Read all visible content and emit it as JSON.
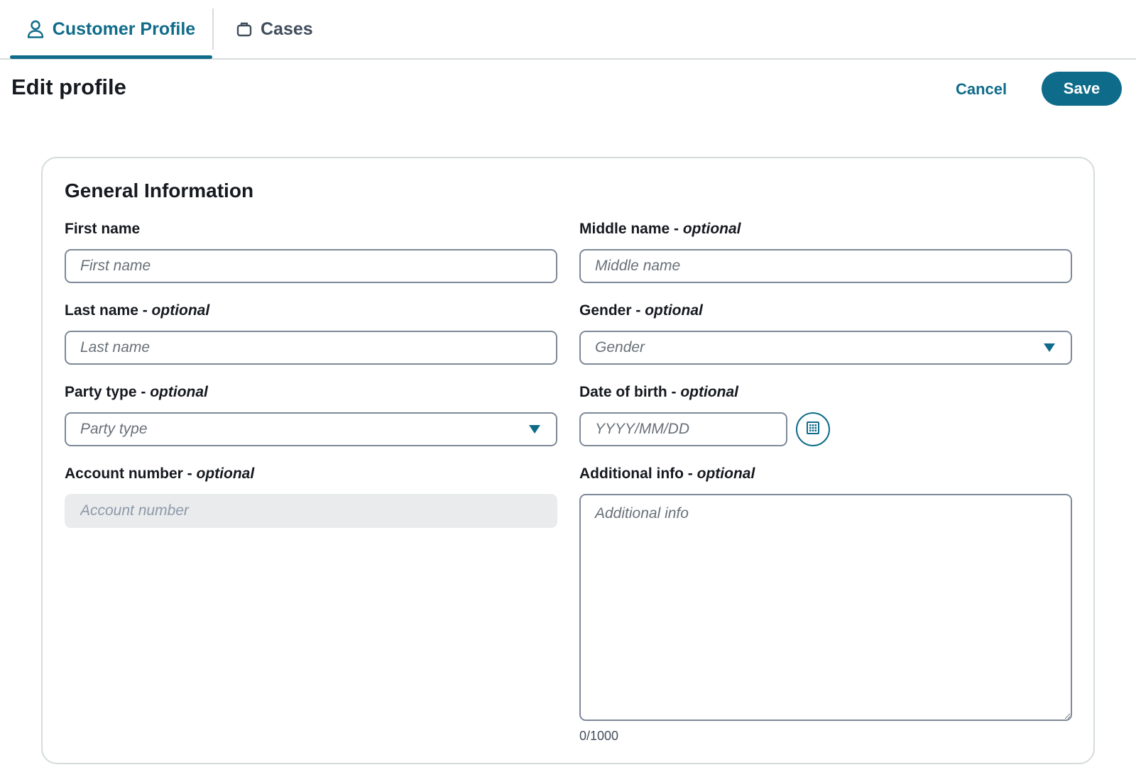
{
  "tabs": [
    {
      "label": "Customer Profile",
      "icon": "user-icon",
      "active": true
    },
    {
      "label": "Cases",
      "icon": "briefcase-icon",
      "active": false
    }
  ],
  "header": {
    "title": "Edit profile",
    "cancel_label": "Cancel",
    "save_label": "Save"
  },
  "colors": {
    "accent": "#0f6b8a",
    "border": "#7d8998",
    "disabled_bg": "#e9ebed"
  },
  "form": {
    "section_title": "General Information",
    "first_name": {
      "label": "First name",
      "placeholder": "First name"
    },
    "middle_name": {
      "label": "Middle name - ",
      "optional": "optional",
      "placeholder": "Middle name"
    },
    "last_name": {
      "label": "Last name - ",
      "optional": "optional",
      "placeholder": "Last name"
    },
    "gender": {
      "label": "Gender - ",
      "optional": "optional",
      "placeholder": "Gender"
    },
    "party_type": {
      "label": "Party type - ",
      "optional": "optional",
      "placeholder": "Party type"
    },
    "date_of_birth": {
      "label": "Date of birth - ",
      "optional": "optional",
      "placeholder": "YYYY/MM/DD"
    },
    "account_number": {
      "label": "Account number - ",
      "optional": "optional",
      "placeholder": "Account number",
      "disabled": true
    },
    "additional_info": {
      "label": "Additional info - ",
      "optional": "optional",
      "placeholder": "Additional info",
      "counter": "0/1000"
    }
  }
}
